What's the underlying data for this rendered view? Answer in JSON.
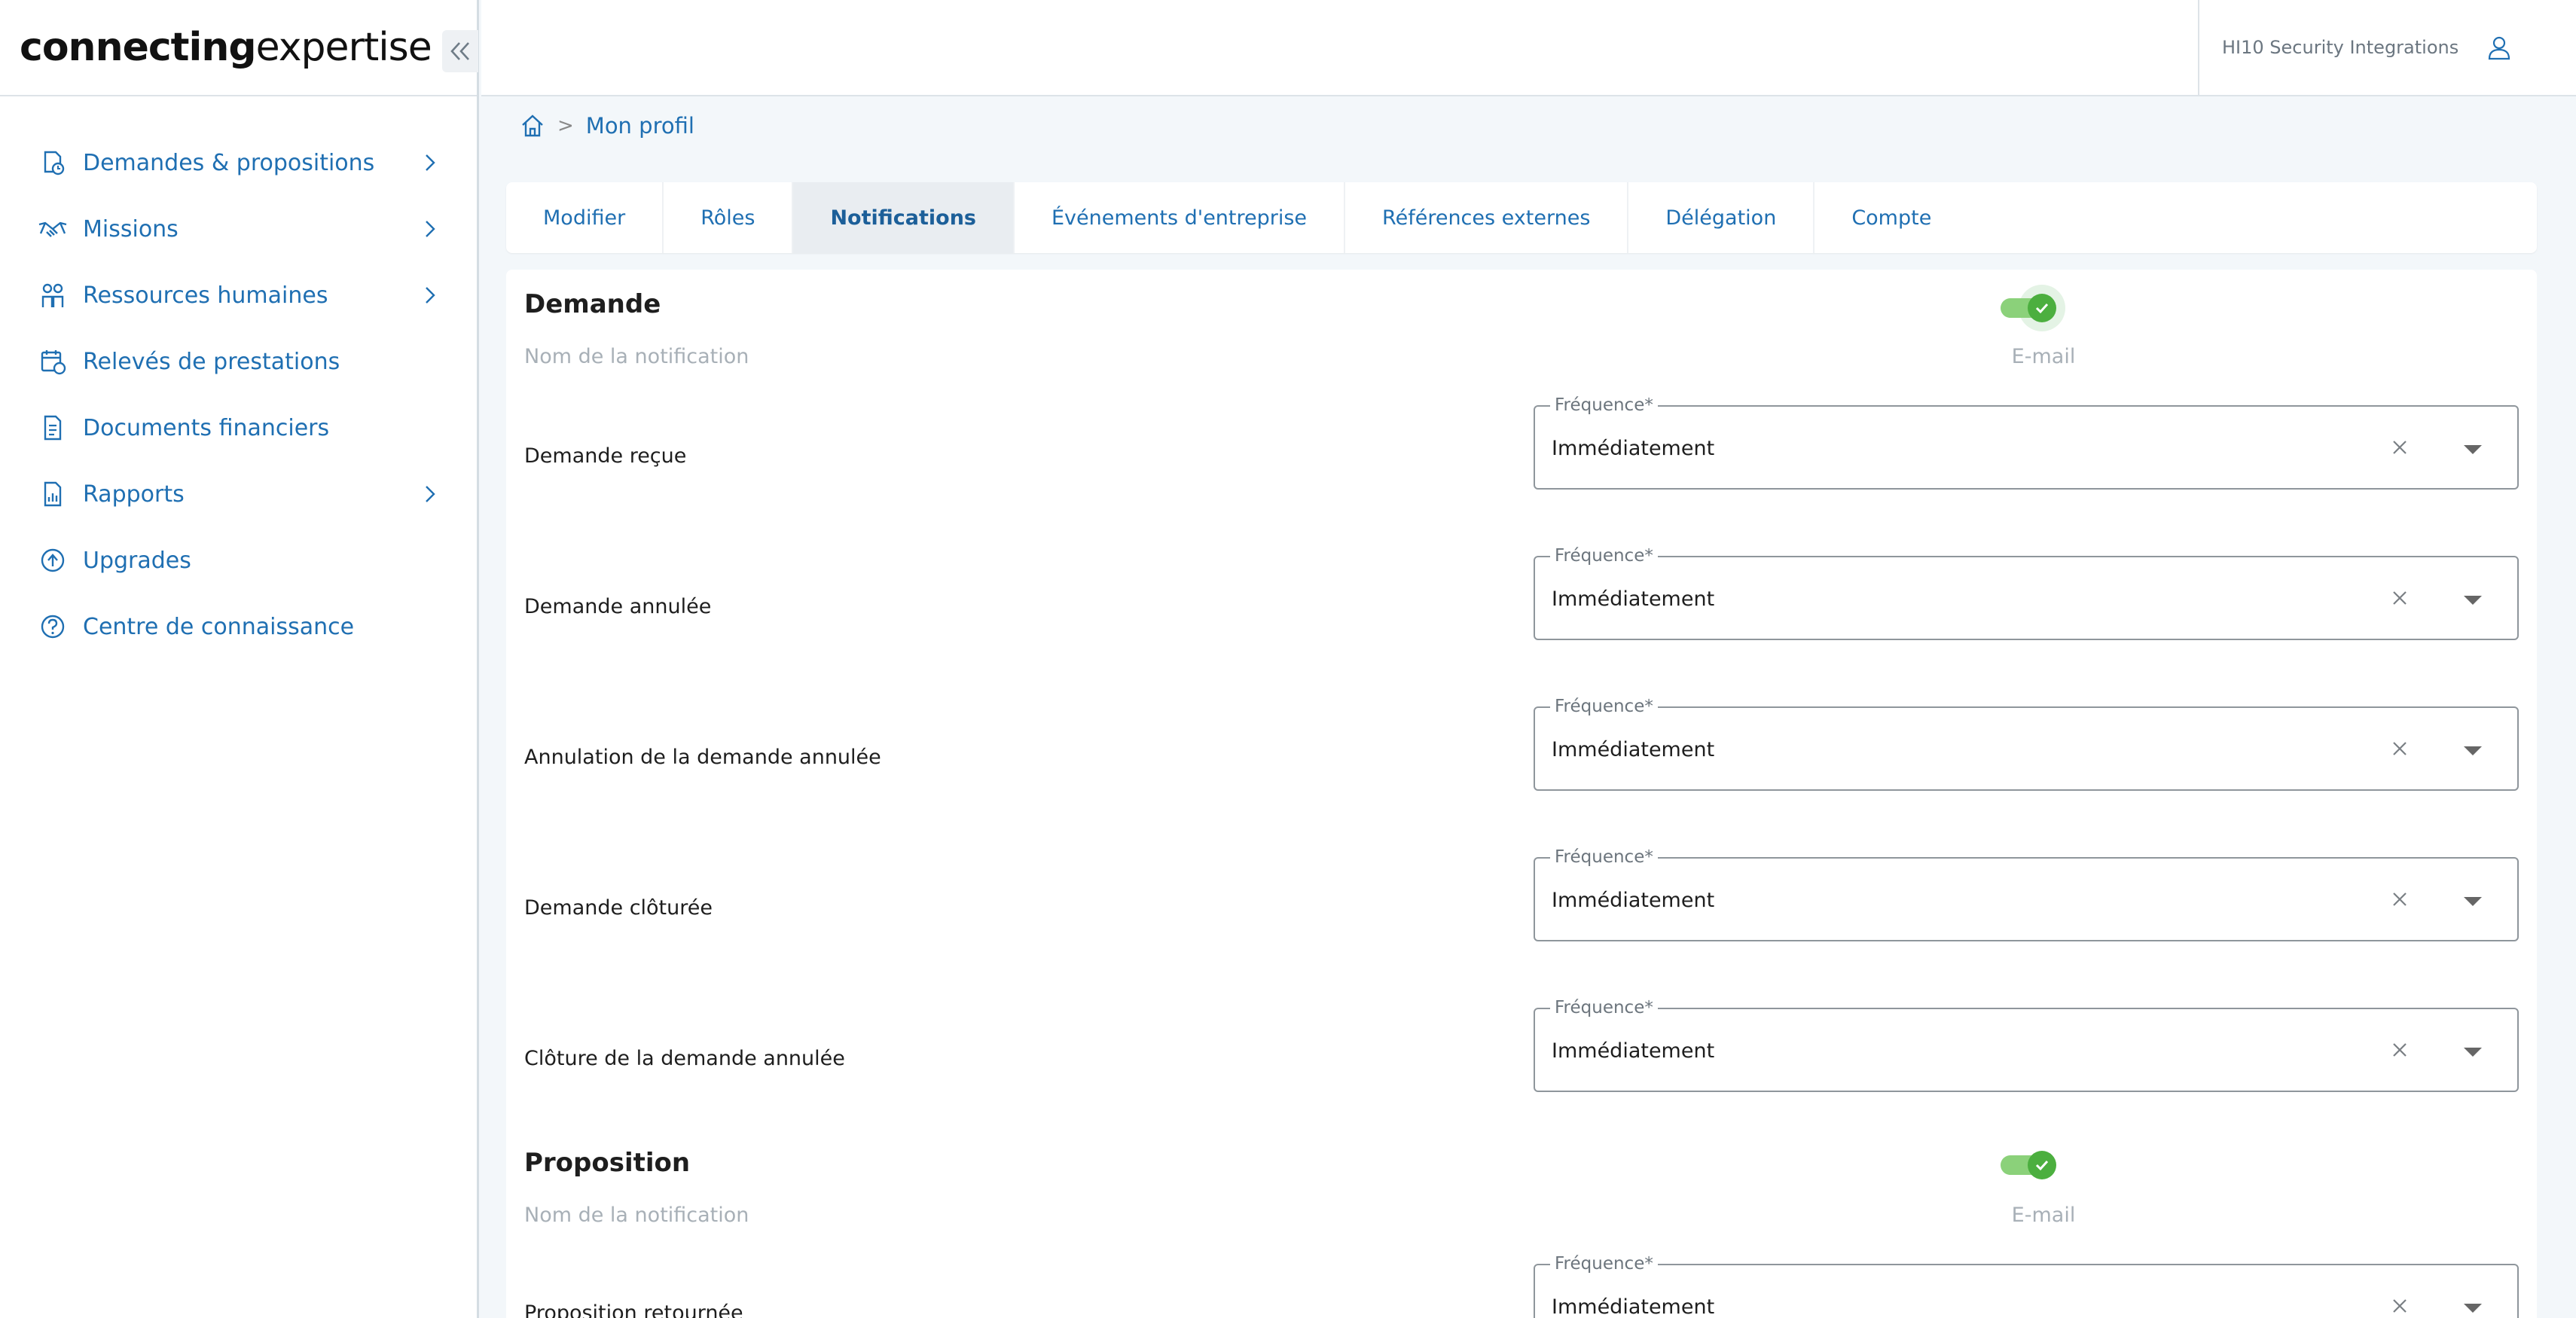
{
  "logo": {
    "text_bold": "connecting",
    "text_light": "expertise"
  },
  "sidebar": {
    "items": [
      {
        "label": "Demandes & propositions",
        "icon": "file-clock-icon",
        "has_children": true
      },
      {
        "label": "Missions",
        "icon": "handshake-icon",
        "has_children": true
      },
      {
        "label": "Ressources humaines",
        "icon": "people-icon",
        "has_children": true
      },
      {
        "label": "Relevés de prestations",
        "icon": "calendar-clock-icon",
        "has_children": false
      },
      {
        "label": "Documents financiers",
        "icon": "document-icon",
        "has_children": false
      },
      {
        "label": "Rapports",
        "icon": "report-icon",
        "has_children": true
      },
      {
        "label": "Upgrades",
        "icon": "upgrade-icon",
        "has_children": false
      },
      {
        "label": "Centre de connaissance",
        "icon": "help-icon",
        "has_children": false
      }
    ]
  },
  "header": {
    "company_name": "HI10 Security Integrations"
  },
  "breadcrumb": {
    "separator": ">",
    "current": "Mon profil"
  },
  "tabs": [
    {
      "label": "Modifier",
      "active": false
    },
    {
      "label": "Rôles",
      "active": false
    },
    {
      "label": "Notifications",
      "active": true
    },
    {
      "label": "Événements d'entreprise",
      "active": false
    },
    {
      "label": "Références externes",
      "active": false
    },
    {
      "label": "Délégation",
      "active": false
    },
    {
      "label": "Compte",
      "active": false
    }
  ],
  "sections": [
    {
      "title": "Demande",
      "column_name": "Nom de la notification",
      "column_email": "E-mail",
      "email_enabled": true,
      "rows": [
        {
          "label": "Demande reçue",
          "field_label": "Fréquence*",
          "value": "Immédiatement"
        },
        {
          "label": "Demande annulée",
          "field_label": "Fréquence*",
          "value": "Immédiatement"
        },
        {
          "label": "Annulation de la demande annulée",
          "field_label": "Fréquence*",
          "value": "Immédiatement"
        },
        {
          "label": "Demande clôturée",
          "field_label": "Fréquence*",
          "value": "Immédiatement"
        },
        {
          "label": "Clôture de la demande annulée",
          "field_label": "Fréquence*",
          "value": "Immédiatement"
        }
      ]
    },
    {
      "title": "Proposition",
      "column_name": "Nom de la notification",
      "column_email": "E-mail",
      "email_enabled": true,
      "rows": [
        {
          "label": "Proposition retournée",
          "field_label": "Fréquence*",
          "value": "Immédiatement"
        }
      ]
    }
  ],
  "colors": {
    "accent": "#1f6fb2",
    "toggle_on": "#4caf3f",
    "logo_blue": "#2a7fc4"
  }
}
